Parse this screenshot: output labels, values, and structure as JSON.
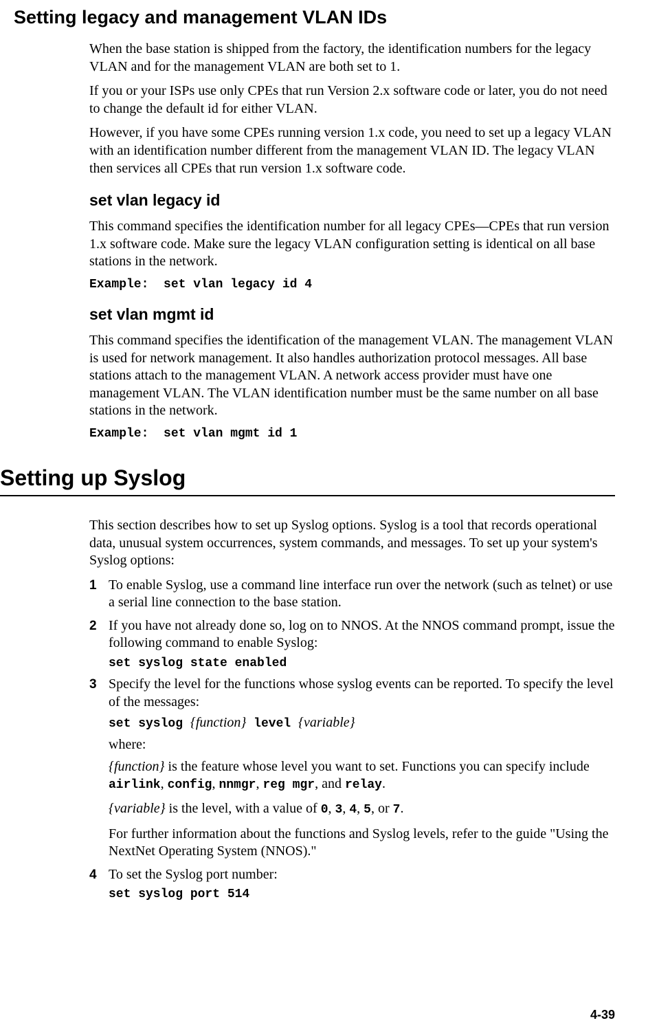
{
  "section1": {
    "title": "Setting legacy and management VLAN IDs",
    "p1": "When the base station is shipped from the factory, the identification numbers for the legacy VLAN and for the management VLAN are both set to 1.",
    "p2": "If you or your ISPs use only CPEs that run Version 2.x software code or later, you do not need to change the default id for either VLAN.",
    "p3": "However, if you have some CPEs running version 1.x code, you need to set up a legacy VLAN with an identification number different from the management VLAN ID. The legacy VLAN then services all CPEs that run version 1.x software code.",
    "sub1": {
      "title": "set vlan legacy id",
      "p1": "This command specifies the identification number for all legacy CPEs—CPEs that run version 1.x software code. Make sure the legacy VLAN configuration setting is identical on all base stations in the network.",
      "example": "Example:  set vlan legacy id 4"
    },
    "sub2": {
      "title": "set vlan mgmt id",
      "p1": "This command specifies the identification of the management VLAN. The management VLAN is used for network management. It also handles authorization protocol messages. All base stations attach to the management VLAN. A network access provider must have one management VLAN. The VLAN identification number must be the same number on all base stations in the network.",
      "example": "Example:  set vlan mgmt id 1"
    }
  },
  "section2": {
    "title": "Setting up Syslog",
    "intro": "This section describes how to set up Syslog options. Syslog is a tool that records operational data, unusual system occurrences, system commands, and messages. To set up your system's Syslog options:",
    "steps": {
      "s1": "To enable Syslog, use a command line interface run over the network (such as telnet) or use a serial line connection to the base station.",
      "s2": "If you have not already done so, log on to NNOS. At the NNOS command prompt, issue the following command to enable Syslog:",
      "s2_cmd": "set syslog state enabled",
      "s3": "Specify the level for the functions whose syslog events can be reported. To specify the level of the messages:",
      "s3_cmd_pre": "set syslog ",
      "s3_cmd_fn": "{function}",
      "s3_cmd_mid": " level ",
      "s3_cmd_var": "{variable}",
      "s3_where": "where:",
      "s3_def_fn_lead": "{function}",
      "s3_def_fn_text": " is the feature whose level you want to set. Functions you can specify include ",
      "s3_def_fn_opts": {
        "a": "airlink",
        "b": "config",
        "c": "nnmgr",
        "d": "reg mgr",
        "e": "relay"
      },
      "s3_def_fn_and": ", and ",
      "s3_def_fn_period": ".",
      "s3_def_var_lead": "{variable}",
      "s3_def_var_text": " is the level, with a value of ",
      "s3_def_var_vals": {
        "v0": "0",
        "v3": "3",
        "v4": "4",
        "v5": "5",
        "v7": "7"
      },
      "s3_def_var_or": ", or ",
      "s3_def_var_period": ".",
      "s3_ref": "For further information about the functions and Syslog levels, refer to the guide \"Using the NextNet Operating System (NNOS).\"",
      "s4": "To set the Syslog port number:",
      "s4_cmd": "set syslog port 514"
    }
  },
  "page_number": "4-39",
  "sep": ", "
}
